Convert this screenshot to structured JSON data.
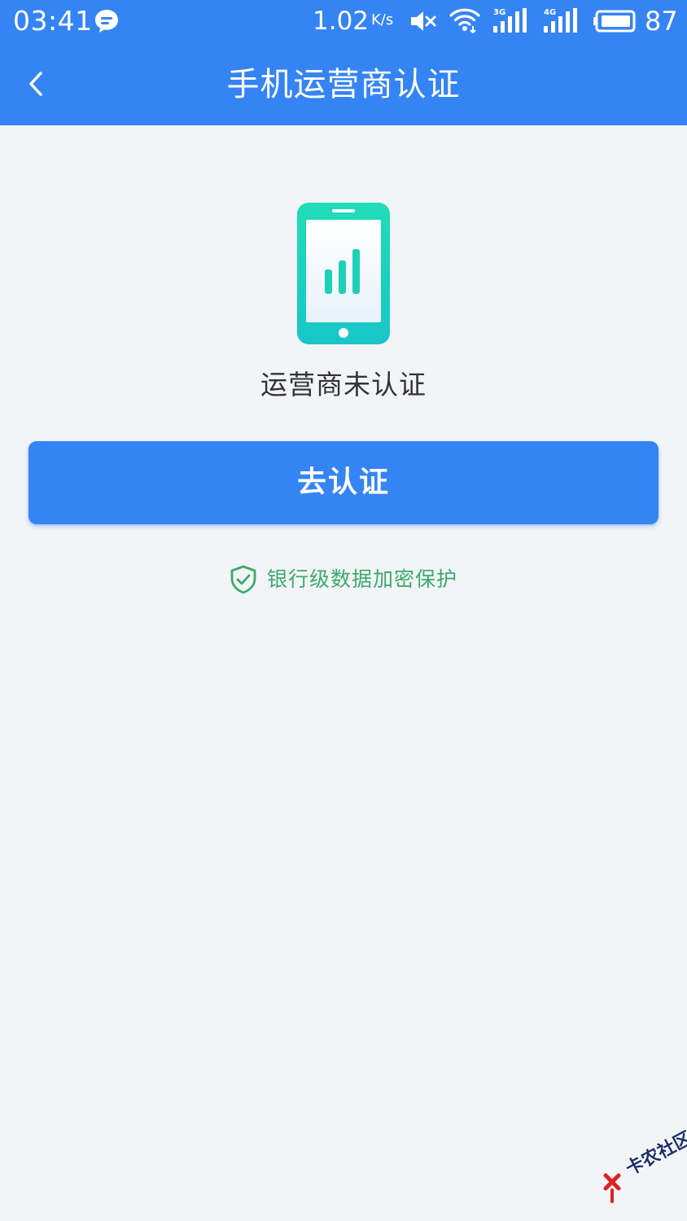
{
  "status_bar": {
    "time": "03:41",
    "net_speed": "1.02",
    "net_speed_unit": "K/s",
    "battery_level": "87",
    "icons": [
      "message-icon",
      "mute-icon",
      "wifi-icon",
      "signal-3g-icon",
      "signal-4g-icon",
      "battery-icon"
    ]
  },
  "header": {
    "title": "手机运营商认证",
    "back_icon": "chevron-left-icon"
  },
  "main": {
    "illustration_icon": "phone-signal-icon",
    "status_label": "运营商未认证",
    "verify_button_label": "去认证",
    "security_note": "银行级数据加密保护",
    "security_icon": "shield-check-icon"
  },
  "watermark": {
    "text": "卡农社区"
  },
  "colors": {
    "primary_blue": "#3584f4",
    "background": "#f3f4f8",
    "security_green": "#3aab6a",
    "illustration_teal": "#1fd0b8",
    "text_dark": "#333333"
  }
}
